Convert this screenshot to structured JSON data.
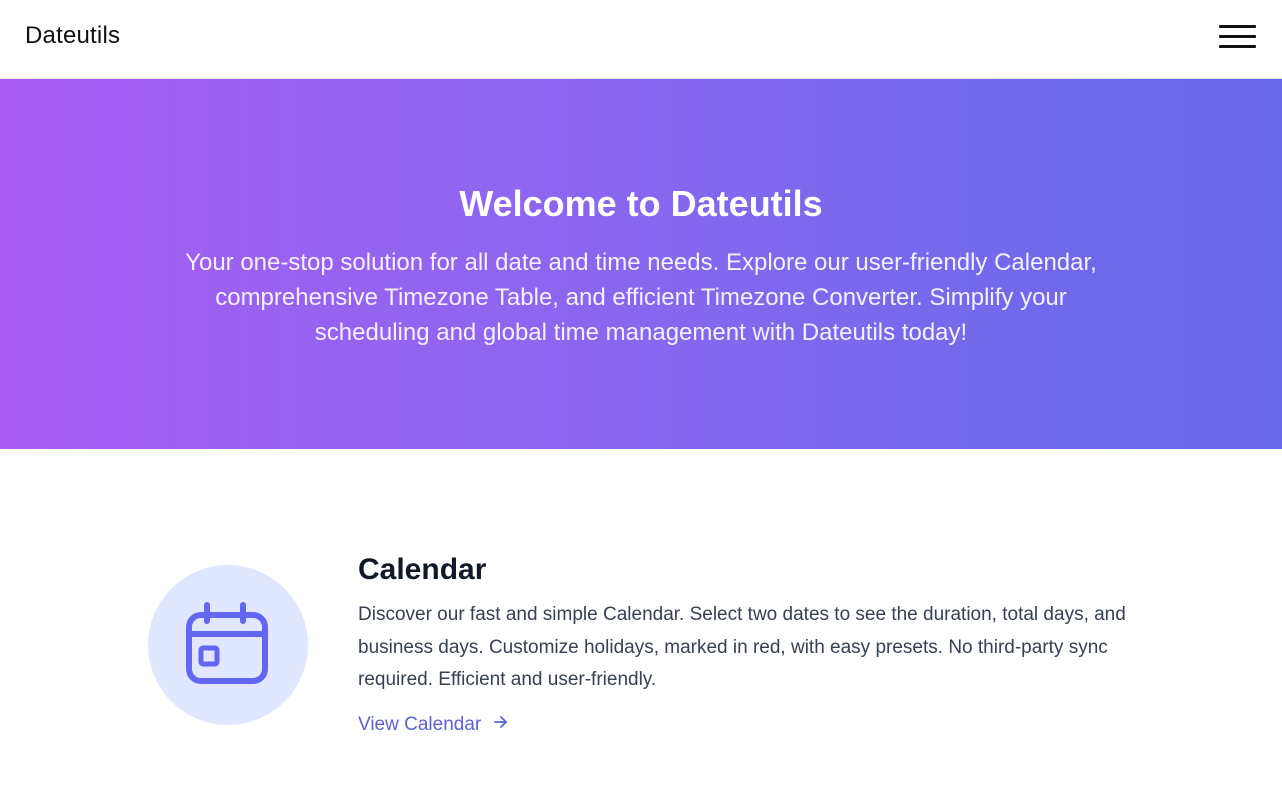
{
  "navbar": {
    "brand": "Dateutils",
    "menu_icon": "hamburger-menu-icon"
  },
  "hero": {
    "title": "Welcome to Dateutils",
    "description": "Your one-stop solution for all date and time needs. Explore our user-friendly Calendar, comprehensive Timezone Table, and efficient Timezone Converter. Simplify your scheduling and global time management with Dateutils today!"
  },
  "features": [
    {
      "icon": "calendar-icon",
      "title": "Calendar",
      "description": "Discover our fast and simple Calendar. Select two dates to see the duration, total days, and business days. Customize holidays, marked in red, with easy presets. No third-party sync required. Efficient and user-friendly.",
      "link_label": "View Calendar",
      "link_icon": "arrow-right-icon"
    }
  ],
  "colors": {
    "hero_gradient_start": "#a75cf2",
    "hero_gradient_end": "#6667e9",
    "accent": "#5b63d3",
    "icon_bg": "#e0e7ff",
    "icon_color": "#6366f1"
  }
}
